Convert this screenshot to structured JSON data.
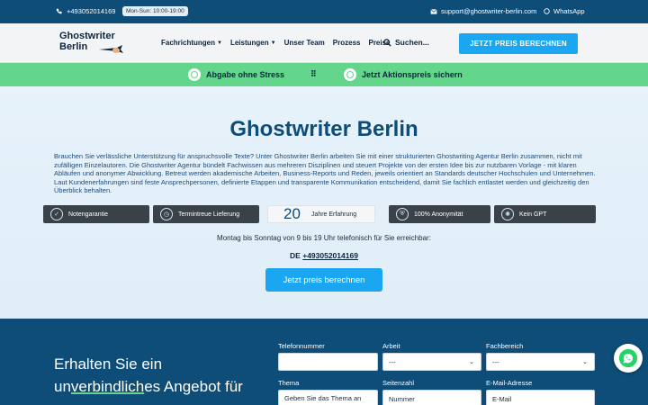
{
  "topbar": {
    "phone": "+493052014169",
    "hours": "Mon-Sun: 10:00-19:00",
    "email": "support@ghostwriter-berlin.com",
    "whatsapp": "WhatsApp"
  },
  "nav": {
    "logo_line1": "Ghostwriter",
    "logo_line2": "Berlin",
    "items": [
      {
        "label": "Fachrichtungen",
        "dropdown": true
      },
      {
        "label": "Leistungen",
        "dropdown": true
      },
      {
        "label": "Unser Team",
        "dropdown": false
      },
      {
        "label": "Prozess",
        "dropdown": false
      },
      {
        "label": "Preise",
        "dropdown": false
      }
    ],
    "search_label": "Suchen...",
    "cta": "JETZT PREIS BERECHNEN"
  },
  "greenbar": {
    "item1": "Abgabe ohne Stress",
    "item2": "Jetzt Aktionspreis sichern"
  },
  "hero": {
    "title": "Ghostwriter Berlin",
    "intro": "Brauchen Sie verlässliche Unterstützung für anspruchsvolle Texte? Unter Ghostwriter Berlin arbeiten Sie mit einer strukturierten Ghostwriting Agentur Berlin zusammen, nicht mit zufälligen Einzelautoren. Die Ghostwriter Agentur bündelt Fachwissen aus mehreren Disziplinen und steuert Projekte von der ersten Idee bis zur nutzbaren Vorlage - mit klaren Abläufen und anonymer Abwicklung. Betreut werden akademische Arbeiten, Business-Reports und Reden, jeweils orientiert an Standards deutscher Hochschulen und Unternehmen. Laut Kundenerfahrungen sind feste Ansprechpersonen, definierte Etappen und transparente Kommunikation entscheidend, damit Sie fachlich entlastet werden und gleichzeitig den Überblick behalten.",
    "badges": {
      "notengarantie": "Notengarantie",
      "termintreue": "Termintreue Lieferung",
      "years_num": "20",
      "years_label": "Jahre Erfahrung",
      "anonymitaet": "100% Anonymität",
      "kein_gpt": "Kein GPT"
    },
    "availability": "Montag bis Sonntag von 9 bis 19 Uhr telefonisch für Sie erreichbar:",
    "de_label": "DE",
    "de_phone": "+493052014169",
    "cta": "Jetzt preis berechnen"
  },
  "form": {
    "heading_line1": "Erhalten Sie ein",
    "heading_line2_pre": "un",
    "heading_line2_u": "verbindlich",
    "heading_line2_post": "es Angebot für",
    "telefon_label": "Telefonnummer",
    "telefon_value": "",
    "arbeit_label": "Arbeit",
    "arbeit_value": "---",
    "fach_label": "Fachbereich",
    "fach_value": "---",
    "thema_label": "Thema",
    "thema_placeholder": "Geben Sie das Thema an",
    "seiten_label": "Seitenzahl",
    "seiten_placeholder": "Nummer",
    "email_label": "E-Mail-Adresse",
    "email_placeholder": "E-Mail"
  },
  "colors": {
    "brand_dark": "#0d4d78",
    "accent_blue": "#1aa6f0",
    "green": "#63d68b"
  }
}
